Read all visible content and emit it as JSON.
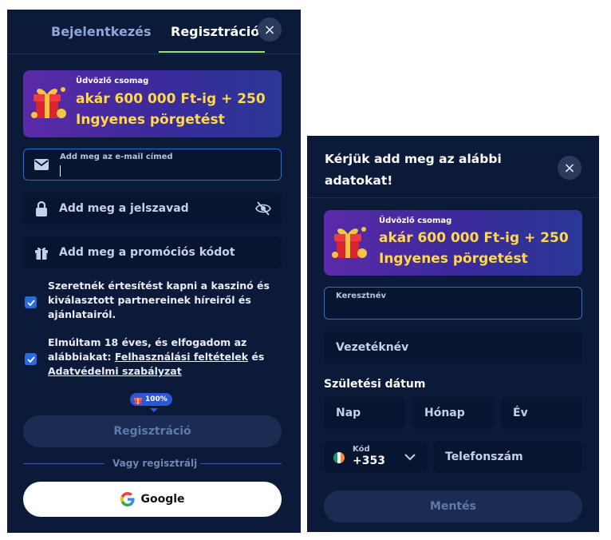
{
  "registration": {
    "tabs": {
      "login": "Bejelentkezés",
      "register": "Regisztráció"
    },
    "close_icon": "×",
    "promo": {
      "label": "Üdvözlő csomag",
      "line1": "akár 600 000 Ft-ig + 250",
      "line2": "Ingyenes pörgetést"
    },
    "email": {
      "label": "Add meg az e-mail címed",
      "value": ""
    },
    "password": {
      "placeholder": "Add meg a jelszavad"
    },
    "promo_code": {
      "placeholder": "Add meg a promóciós kódot"
    },
    "consent_marketing": {
      "line1": "Szeretnék értesítést kapni a kaszinó és",
      "line2": "kiválasztott partnereinek híreiről és",
      "line3": "ajánlatairól.",
      "checked": true
    },
    "consent_terms": {
      "line1": "Elmúltam 18 éves, és elfogadom az",
      "line2_prefix": "alábbiakat: ",
      "terms_link": "Felhasználási feltételek",
      "line2_suffix": " és",
      "privacy_link": "Adatvédelmi szabályzat",
      "checked": true
    },
    "progress_badge": "100%",
    "submit_button": "Regisztráció",
    "or_text": "Vagy regisztrálj",
    "google_button": "Google"
  },
  "details": {
    "title_line1": "Kérjük add meg az alábbi",
    "title_line2": "adatokat!",
    "close_icon": "×",
    "promo": {
      "label": "Üdvözlő csomag",
      "line1": "akár 600 000 Ft-ig + 250",
      "line2": "Ingyenes pörgetést"
    },
    "first_name": {
      "label": "Keresztnév",
      "value": ""
    },
    "last_name": {
      "placeholder": "Vezetéknév"
    },
    "birth_label": "Születési dátum",
    "day": "Nap",
    "month": "Hónap",
    "year": "Év",
    "phone_code": {
      "label": "Kód",
      "value": "+353"
    },
    "phone": {
      "placeholder": "Telefonszám"
    },
    "save_button": "Mentés"
  },
  "colors": {
    "panel_bg": "#0c1a3a",
    "field_bg": "#081530",
    "accent_green": "#9be26a",
    "promo_yellow": "#ffd94a",
    "checkbox_blue": "#2a6ae0"
  }
}
